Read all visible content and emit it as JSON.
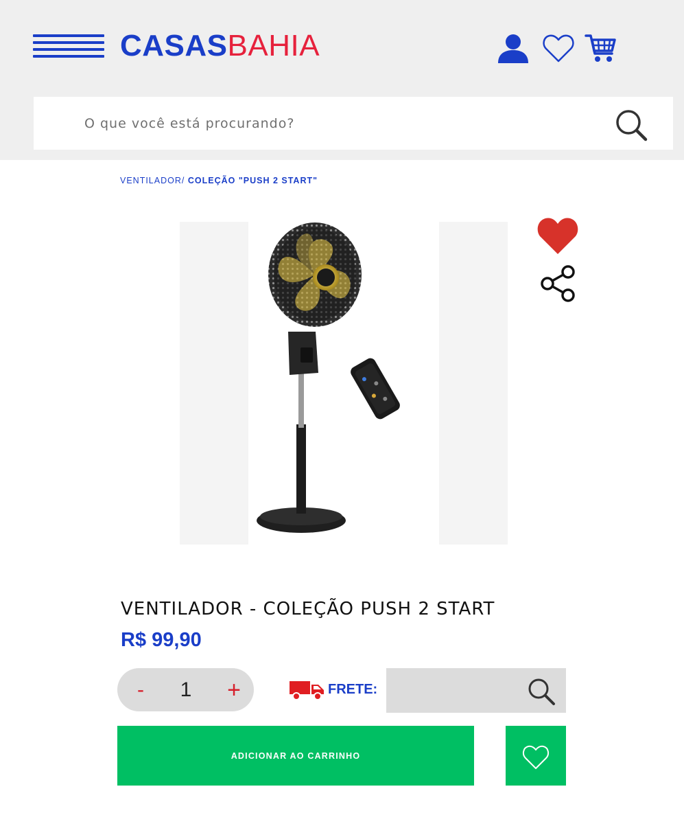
{
  "header": {
    "logo": {
      "part1": "CASAS",
      "part2": "BAHIA"
    },
    "colors": {
      "primary": "#1a3ec8",
      "accent": "#e6213c",
      "background": "#efefef"
    },
    "icons": [
      "menu-icon",
      "user-icon",
      "heart-outline-icon",
      "cart-icon"
    ]
  },
  "search": {
    "placeholder": "O que você está procurando?",
    "value": ""
  },
  "breadcrumb": {
    "parent": "VENTILADOR/",
    "current": "COLEÇÃO \"PUSH 2 START\""
  },
  "product": {
    "title": "VENTILADOR - COLEÇÃO PUSH 2 START",
    "price": "R$ 99,90",
    "image_icon": "fan-with-remote-image",
    "favorite_color": "#d7322a"
  },
  "quantity": {
    "minus": "-",
    "value": "1",
    "plus": "+"
  },
  "shipping": {
    "label": "FRETE:",
    "value": "",
    "icon": "truck-icon",
    "icon_color": "#e01e22"
  },
  "actions": {
    "add_to_cart": "ADICIONAR AO CARRINHO",
    "button_color": "#00bf63"
  }
}
